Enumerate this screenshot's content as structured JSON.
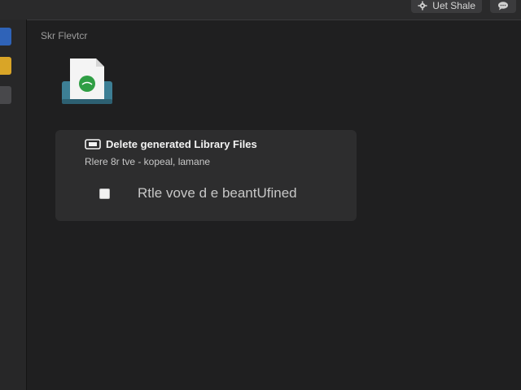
{
  "topbar": {
    "share_label": "Uet Shale",
    "share_icon": "gear-icon",
    "more_icon": "chat-bubble-icon"
  },
  "dock": {
    "items": [
      {
        "icon": "blue-app-icon",
        "color": "#2f63b8"
      },
      {
        "icon": "yellow-app-icon",
        "color": "#d9a527"
      },
      {
        "icon": "gray-app-icon",
        "color": "#48484b"
      }
    ]
  },
  "section": {
    "label": "Skr Flevtcr"
  },
  "file_icon": {
    "icon": "document-file-icon",
    "accent_color": "#2f9e44"
  },
  "dialog": {
    "title": "Delete generated Library Files",
    "subtitle": "Rlere 8r tve - kopeal, lamane",
    "option": {
      "label": "Rtle vove d e beantUfined",
      "checked": false
    }
  },
  "colors": {
    "background": "#1f1f20",
    "card": "#2d2d2e",
    "text_primary": "#f3f3f3",
    "text_secondary": "#c7c7c7"
  }
}
